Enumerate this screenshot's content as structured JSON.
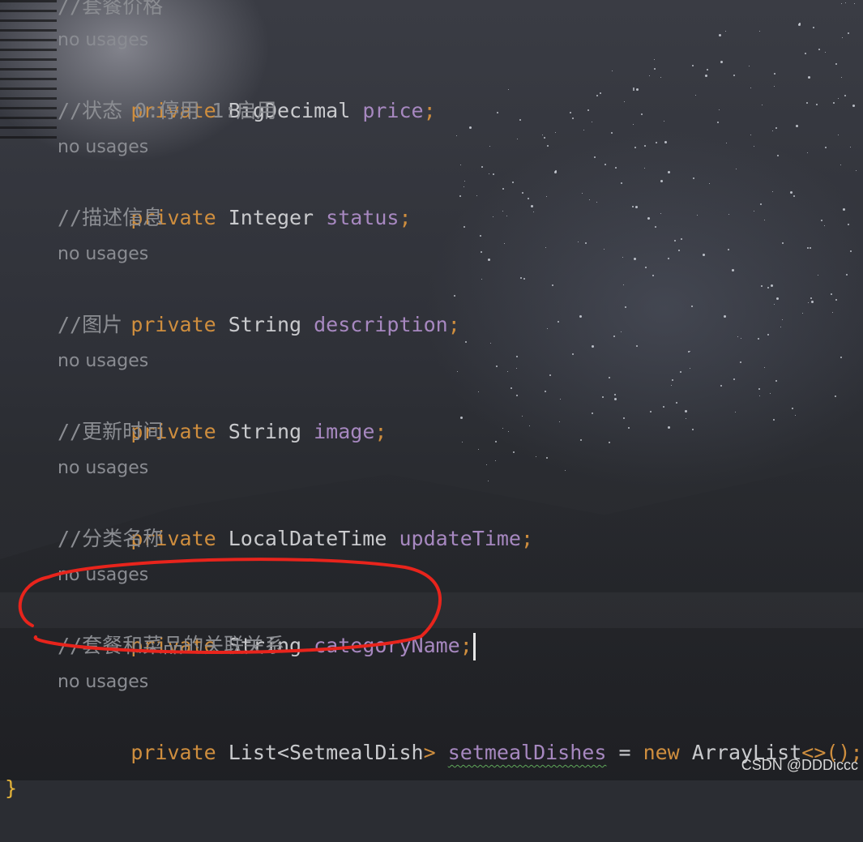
{
  "colors": {
    "keyword": "#cf8e3e",
    "type": "#c9cacd",
    "field": "#a788c0",
    "comment": "#8b8d92",
    "hint": "#8a8c92",
    "brace": "#e4b33a",
    "annotation_circle": "#e8241c"
  },
  "editor": {
    "lines": [
      {
        "comment": "//套餐价格"
      },
      {
        "hint": "no usages"
      },
      {
        "kw": "private",
        "type": "BigDecimal",
        "field": "price",
        "semi": ";"
      },
      {
        "comment": "//状态 0:停用 1:启用"
      },
      {
        "hint": "no usages"
      },
      {
        "kw": "private",
        "type": "Integer",
        "field": "status",
        "semi": ";"
      },
      {
        "comment": "//描述信息"
      },
      {
        "hint": "no usages"
      },
      {
        "kw": "private",
        "type": "String",
        "field": "description",
        "semi": ";"
      },
      {
        "comment": "//图片"
      },
      {
        "hint": "no usages"
      },
      {
        "kw": "private",
        "type": "String",
        "field": "image",
        "semi": ";"
      },
      {
        "comment": "//更新时间"
      },
      {
        "hint": "no usages"
      },
      {
        "kw": "private",
        "type": "LocalDateTime",
        "field": "updateTime",
        "semi": ";"
      },
      {
        "comment": "//分类名称"
      },
      {
        "hint": "no usages"
      },
      {
        "kw": "private",
        "type": "String",
        "field": "categoryName",
        "semi": ";"
      },
      {
        "comment": "//套餐和菜品的关联关系"
      },
      {
        "hint": "no usages"
      },
      {
        "kw": "private",
        "type_a": "List",
        "lt": "<",
        "type_b": "SetmealDish",
        "gt": ">",
        "field": "setmealDishes",
        "eq": "=",
        "new_kw": "new",
        "ctor": "ArrayList",
        "diamond": "<>",
        "call": "();"
      }
    ],
    "closing_brace": "}"
  },
  "watermark": "CSDN @DDDiccc"
}
